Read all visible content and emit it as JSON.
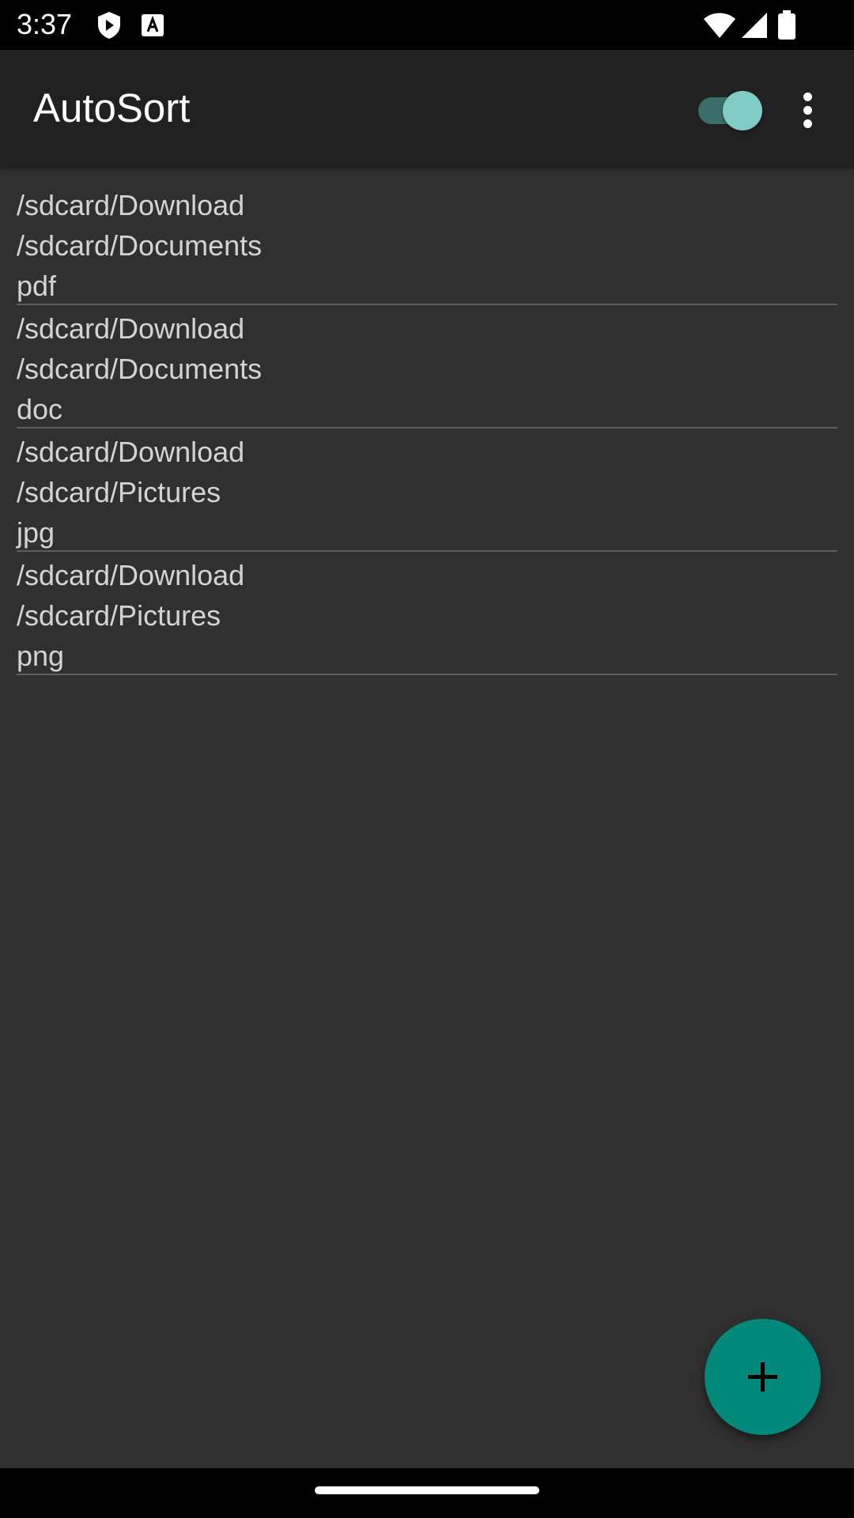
{
  "status_bar": {
    "time": "3:37",
    "left_icons": [
      "shield-play-icon",
      "text-a-icon"
    ],
    "right_icons": [
      "wifi-icon",
      "cell-signal-icon",
      "battery-icon"
    ]
  },
  "app_bar": {
    "title": "AutoSort",
    "toggle_on": true,
    "accent_color": "#80cbc4",
    "background_color": "#212121"
  },
  "rules": [
    {
      "source": "/sdcard/Download",
      "destination": "/sdcard/Documents",
      "extension": "pdf"
    },
    {
      "source": "/sdcard/Download",
      "destination": "/sdcard/Documents",
      "extension": "doc"
    },
    {
      "source": "/sdcard/Download",
      "destination": "/sdcard/Pictures",
      "extension": "jpg"
    },
    {
      "source": "/sdcard/Download",
      "destination": "/sdcard/Pictures",
      "extension": "png"
    }
  ],
  "fab": {
    "icon": "plus-icon",
    "color": "#00897b"
  },
  "theme": {
    "background": "#303030",
    "text": "#d4d4d4",
    "divider": "#5e5e5e"
  }
}
